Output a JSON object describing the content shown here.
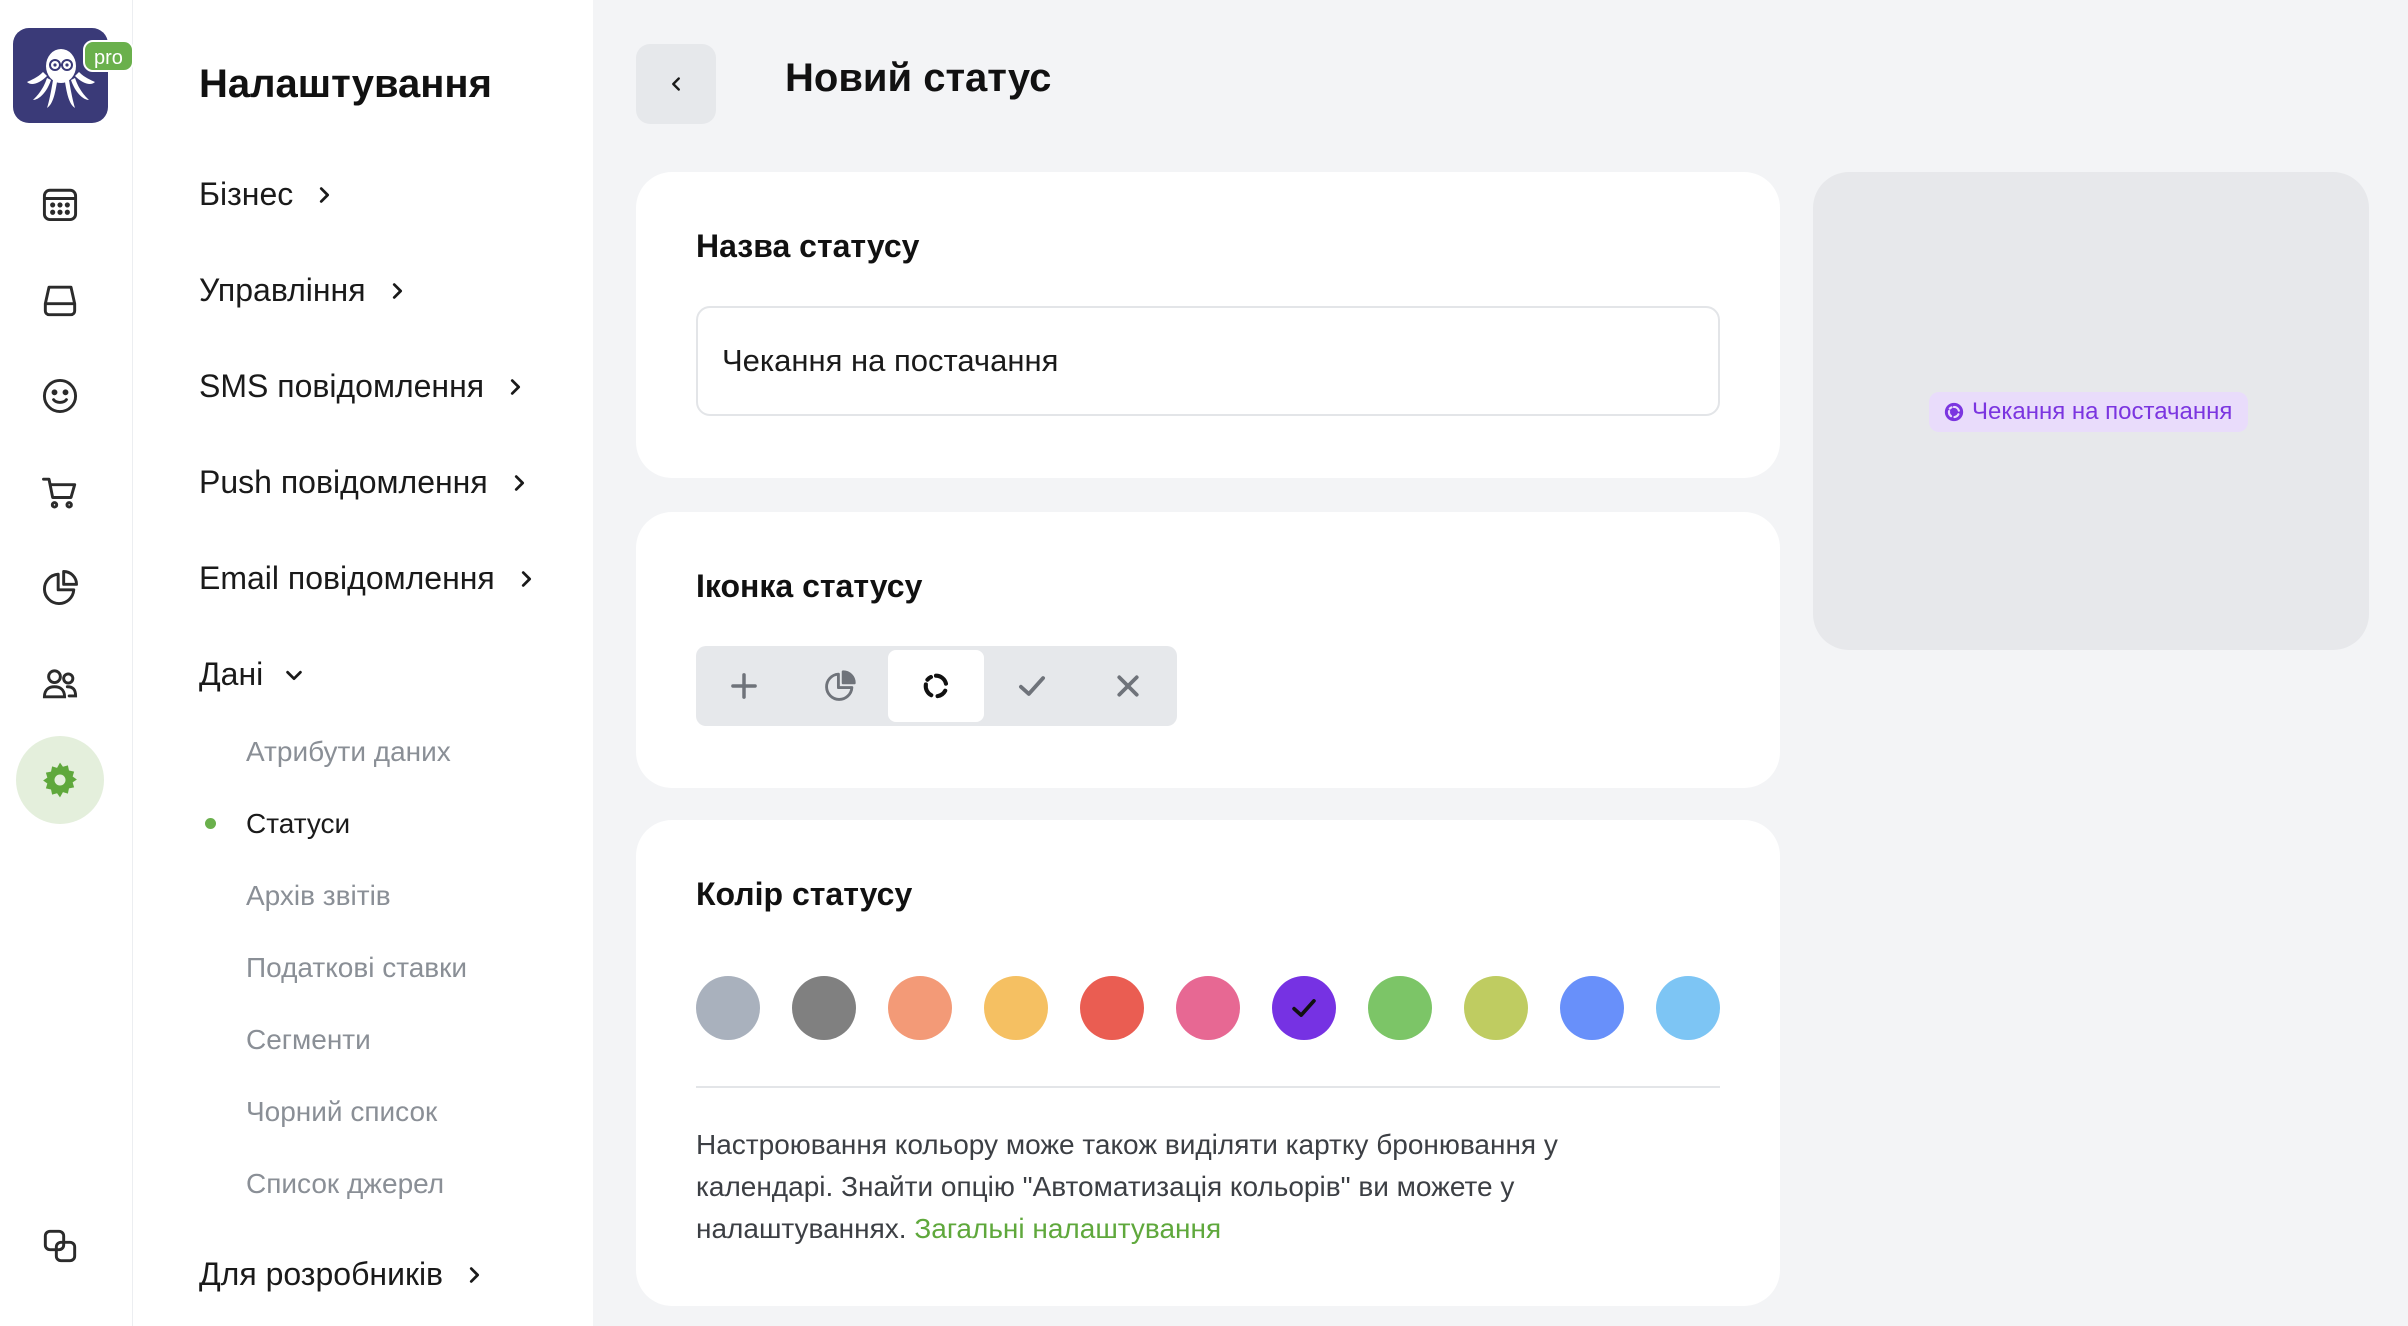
{
  "app": {
    "badge": "pro"
  },
  "rail": {
    "items": [
      {
        "name": "calendar-icon",
        "active": false
      },
      {
        "name": "inbox-icon",
        "active": false
      },
      {
        "name": "smile-icon",
        "active": false
      },
      {
        "name": "cart-icon",
        "active": false
      },
      {
        "name": "pie-chart-icon",
        "active": false
      },
      {
        "name": "users-icon",
        "active": false
      },
      {
        "name": "gear-icon",
        "active": true
      },
      {
        "name": "copy-icon",
        "active": false
      }
    ]
  },
  "nav": {
    "title": "Налаштування",
    "items": [
      {
        "label": "Бізнес",
        "expanded": false
      },
      {
        "label": "Управління",
        "expanded": false
      },
      {
        "label": "SMS повідомлення",
        "expanded": false
      },
      {
        "label": "Push повідомлення",
        "expanded": false
      },
      {
        "label": "Email повідомлення",
        "expanded": false
      },
      {
        "label": "Дані",
        "expanded": true
      },
      {
        "label": "Для розробників",
        "expanded": false
      }
    ],
    "subitems": [
      {
        "label": "Атрибути даних",
        "active": false
      },
      {
        "label": "Статуси",
        "active": true
      },
      {
        "label": "Архів звітів",
        "active": false
      },
      {
        "label": "Податкові ставки",
        "active": false
      },
      {
        "label": "Сегменти",
        "active": false
      },
      {
        "label": "Чорний список",
        "active": false
      },
      {
        "label": "Список джерел",
        "active": false
      }
    ]
  },
  "header": {
    "title": "Новий статус"
  },
  "name_card": {
    "title": "Назва статусу",
    "value": "Чекання на постачання"
  },
  "icon_card": {
    "title": "Іконка статусу",
    "options": [
      "plus-icon",
      "pie-chart-icon",
      "loading-ring-icon",
      "check-icon",
      "close-icon"
    ],
    "selected": "loading-ring-icon"
  },
  "color_card": {
    "title": "Колір статусу",
    "colors": [
      "#a9b1bd",
      "#808080",
      "#f39a77",
      "#f5c062",
      "#ea5d52",
      "#e76893",
      "#7632e3",
      "#7cc567",
      "#bfcc61",
      "#6890fa",
      "#7dc5f4"
    ],
    "selected": "#7632e3",
    "hint": "Настроювання кольору може також виділяти картку бронювання у календарі. Знайти опцію \"Автоматизація кольорів\" ви можете у налаштуваннях.",
    "hint_link": "Загальні налаштування"
  },
  "preview": {
    "label": "Чекання на постачання",
    "bg": "#e9dcfb",
    "fg": "#7b35e0"
  }
}
